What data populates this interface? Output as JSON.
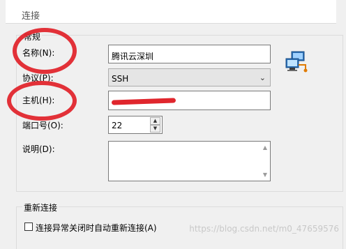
{
  "section": {
    "title": "连接"
  },
  "general": {
    "group_title": "常规",
    "name_label": "名称(N):",
    "name_value": "腾讯云深圳",
    "protocol_label": "协议(P):",
    "protocol_value": "SSH",
    "host_label": "主机(H):",
    "port_label": "端口号(O):",
    "port_value": "22",
    "desc_label": "说明(D):",
    "desc_value": ""
  },
  "reconnect": {
    "group_title": "重新连接",
    "checkbox_label": "连接异常关闭时自动重新连接(A)",
    "checked": false
  },
  "watermark": "https://blog.csdn.net/m0_47659576",
  "icons": {
    "network": "network-computers-icon",
    "dropdown": "chevron-down-icon",
    "spin_up": "spin-up-icon",
    "spin_down": "spin-down-icon"
  },
  "colors": {
    "annotation_red": "#e0262d",
    "panel": "#f0f0f0",
    "border": "#7a7a7a"
  }
}
